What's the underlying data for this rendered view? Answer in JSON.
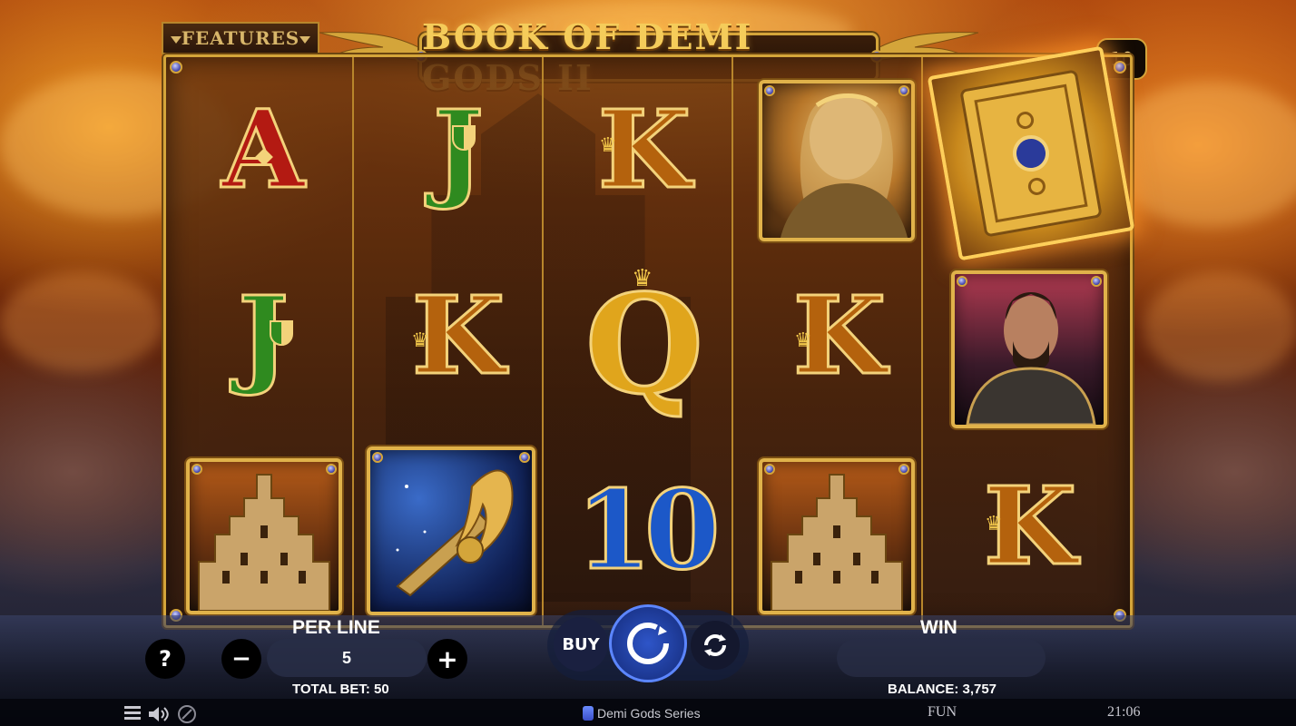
{
  "game": {
    "title": "BOOK OF DEMI GODS II",
    "features_label": "FEATURES",
    "lines": "10",
    "accent_gold": "#d4a53a"
  },
  "reels": [
    [
      "A",
      "J",
      "castle"
    ],
    [
      "J",
      "K",
      "wings"
    ],
    [
      "K",
      "Q",
      "10"
    ],
    [
      "goddess",
      "K",
      "castle"
    ],
    [
      "book",
      "warrior",
      "K"
    ]
  ],
  "symbols": {
    "a": "A",
    "j": "J",
    "k": "K",
    "q": "Q",
    "ten": "10"
  },
  "controls": {
    "per_line_label": "PER LINE",
    "per_line_value": "5",
    "help": "?",
    "minus": "−",
    "plus": "+",
    "total_bet": "TOTAL BET: 50",
    "buy": "BUY",
    "win_label": "WIN",
    "balance": "BALANCE: 3,757"
  },
  "footer": {
    "brand": "Demi Gods Series",
    "mode": "FUN",
    "time": "21:06",
    "menu_icon": "menu-icon",
    "sound_icon": "speaker-icon",
    "turbo_icon": "turbo-icon"
  }
}
